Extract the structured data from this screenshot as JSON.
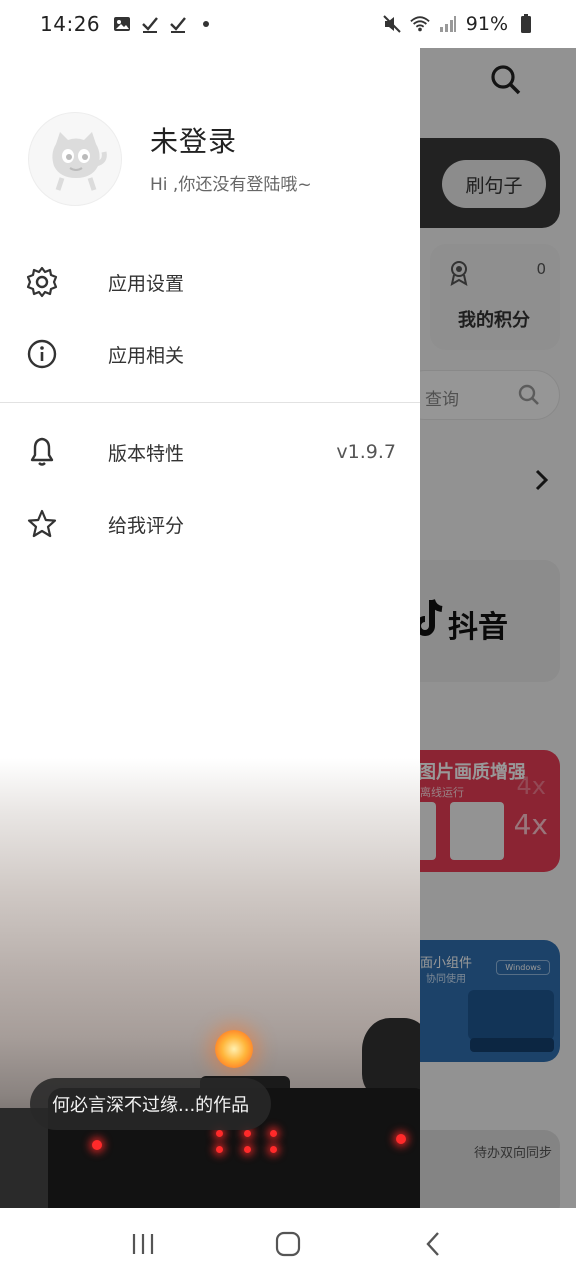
{
  "status_bar": {
    "time": "14:26",
    "battery": "91%",
    "left_icons": [
      "image-icon",
      "check-icon",
      "check-icon",
      "dot-icon"
    ],
    "right_icons": [
      "mute-icon",
      "wifi-icon",
      "signal-icon",
      "battery-icon"
    ]
  },
  "drawer": {
    "user": {
      "name": "未登录",
      "subtitle": "Hi ,你还没有登陆哦~"
    },
    "menu": [
      {
        "label": "应用设置",
        "icon": "gear-icon"
      },
      {
        "label": "应用相关",
        "icon": "info-icon"
      }
    ],
    "menu2": [
      {
        "label": "版本特性",
        "icon": "bell-icon",
        "value": "v1.9.7"
      },
      {
        "label": "给我评分",
        "icon": "star-icon"
      }
    ],
    "toast": "何必言深不过缘...的作品"
  },
  "background_app": {
    "pill_button": "刷句子",
    "points_count": "0",
    "points_label": "我的积分",
    "search_placeholder": "查询",
    "douyin_name": "抖音",
    "enhance_title": "图片画质增强",
    "enhance_sub": "离线运行",
    "enhance_badge": "4x",
    "widget_title": "面小组件",
    "widget_sub": "协同使用",
    "widget_os": "Windows",
    "sync_title": "待办双向同步"
  },
  "nav_bar": {
    "buttons": [
      "recent-apps-icon",
      "home-icon",
      "back-icon"
    ]
  },
  "colors": {
    "enhance_card": "#e83c55",
    "widget_card": "#2f6fb0",
    "accent_dark": "#3a3a3a"
  }
}
